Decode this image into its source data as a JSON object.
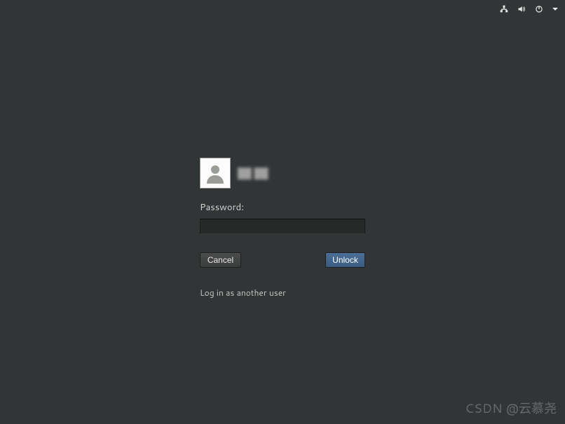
{
  "topbar": {
    "icons": {
      "network": "network-icon",
      "volume": "volume-icon",
      "power": "power-icon",
      "dropdown": "dropdown-icon"
    }
  },
  "login": {
    "username": "██ ██",
    "password_label": "Password:",
    "password_value": "",
    "cancel_label": "Cancel",
    "unlock_label": "Unlock",
    "another_user_label": "Log in as another user"
  },
  "watermark": "CSDN @云慕尧"
}
